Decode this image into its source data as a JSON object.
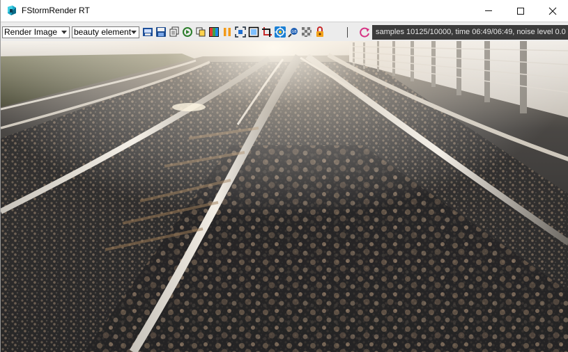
{
  "window": {
    "title": "FStormRender RT"
  },
  "toolbar": {
    "channel_select": "Render Image",
    "element_select": "beauty element",
    "icons": [
      "save-icon",
      "disk-icon",
      "copy-icon",
      "export-icon",
      "clone-icon",
      "color-icon",
      "pause-icon",
      "fit-icon",
      "region-icon",
      "crop-icon",
      "target-icon",
      "zoom-icon",
      "checker-icon",
      "lock-icon"
    ],
    "status": "samples 10125/10000,  time 06:49/06:49,  noise level 0.0"
  },
  "colors": {
    "status_bg": "#3b3b3b",
    "toolbar_bg": "#ececec",
    "accent": "#1a7fd4"
  }
}
